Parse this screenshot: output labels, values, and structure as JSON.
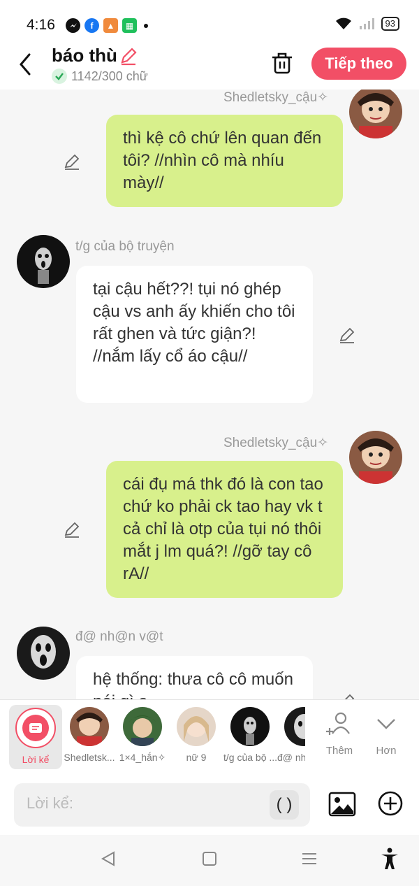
{
  "status": {
    "time": "4:16",
    "battery": "93"
  },
  "header": {
    "title": "báo thù",
    "word_count": "1142/300 chữ",
    "next_label": "Tiếp theo"
  },
  "messages": [
    {
      "side": "right",
      "sender": "Shedletsky_cậu✧",
      "text": "thì kệ cô chứ lên quan đến tôi? //nhìn cô mà nhíu mày//"
    },
    {
      "side": "left",
      "sender": "t/g của bộ truyện",
      "text": "tại cậu hết??! tụi nó ghép cậu vs anh ấy khiến cho tôi rất ghen và tức giận?! //nắm lấy cổ áo cậu//"
    },
    {
      "side": "right",
      "sender": "Shedletsky_cậu✧",
      "text": "cái đụ má thk đó là con tao chứ ko phải ck tao hay vk t cả chỉ là otp của tụi nó thôi mắt j lm quá?! //gỡ tay cô rA//"
    },
    {
      "side": "left",
      "sender": "đ@ nh@n v@t",
      "text": "hệ thống: thưa cô cô muốn nói gì ạ"
    }
  ],
  "characters": {
    "narrator_label": "Lời kể",
    "items": [
      "Shedletsk...",
      "1×4_hắn✧",
      "nữ 9",
      "t/g của bộ ...",
      "đ@ nh..."
    ],
    "more_label": "Thêm",
    "other_label": "Hơn"
  },
  "input": {
    "placeholder": "Lời kể:",
    "paren": "( )"
  }
}
